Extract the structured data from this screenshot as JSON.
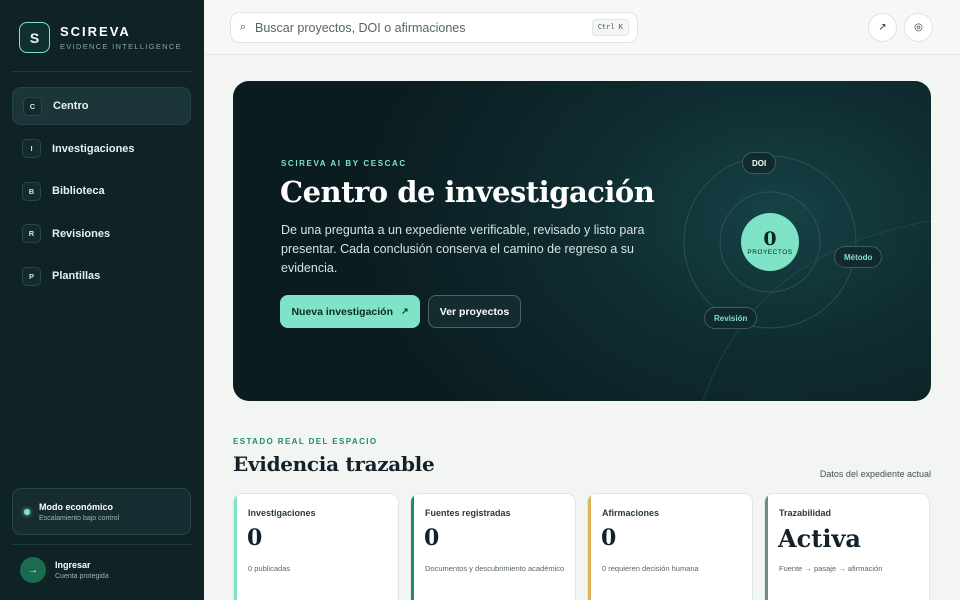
{
  "brand": {
    "logo_letter": "S",
    "name": "SCIREVA",
    "tagline": "EVIDENCE INTELLIGENCE"
  },
  "sidebar": {
    "items": [
      {
        "badge": "C",
        "label": "Centro",
        "active": true
      },
      {
        "badge": "I",
        "label": "Investigaciones",
        "active": false
      },
      {
        "badge": "B",
        "label": "Biblioteca",
        "active": false
      },
      {
        "badge": "R",
        "label": "Revisiones",
        "active": false
      },
      {
        "badge": "P",
        "label": "Plantillas",
        "active": false
      }
    ],
    "eco": {
      "title": "Modo económico",
      "subtitle": "Escalamiento bajo control"
    },
    "login": {
      "icon": "→",
      "title": "Ingresar",
      "subtitle": "Cuenta protegida"
    }
  },
  "search": {
    "placeholder": "Buscar proyectos, DOI o afirmaciones",
    "value": "",
    "shortcut": "Ctrl K",
    "icon": "⌕"
  },
  "topbar": {
    "export_icon": "↗",
    "settings_icon": "◎"
  },
  "hero": {
    "eyebrow": "SCIREVA AI BY CESCAC",
    "title": "Centro de investigación",
    "description": "De una pregunta a un expediente verificable, revisado y listo para presentar. Cada conclusión conserva el camino de regreso a su evidencia.",
    "primary_button": "Nueva investigación",
    "primary_icon": "↗",
    "secondary_button": "Ver proyectos",
    "orbit": {
      "count": "0",
      "count_label": "PROYECTOS",
      "chips": [
        "DOI",
        "Método",
        "Revisión"
      ]
    }
  },
  "section": {
    "eyebrow": "ESTADO REAL DEL ESPACIO",
    "title": "Evidencia trazable",
    "note": "Datos del expediente actual"
  },
  "cards": [
    {
      "label": "Investigaciones",
      "value": "0",
      "sub": "0 publicadas",
      "accent": "#7fe3c8"
    },
    {
      "label": "Fuentes registradas",
      "value": "0",
      "sub": "Documentos y descubrimiento académico",
      "accent": "#1f8b6b"
    },
    {
      "label": "Afirmaciones",
      "value": "0",
      "sub": "0 requieren decisión humana",
      "accent": "#e0b35a"
    },
    {
      "label": "Trazabilidad",
      "value": "Activa",
      "sub": "Fuente → pasaje → afirmación",
      "accent": "#6f8a86"
    }
  ],
  "colors": {
    "accent": "#7fe3c8",
    "sidebar_bg": "#0f2226",
    "hero_bg": "#0f2c30",
    "page_bg": "#f3f5f2"
  }
}
